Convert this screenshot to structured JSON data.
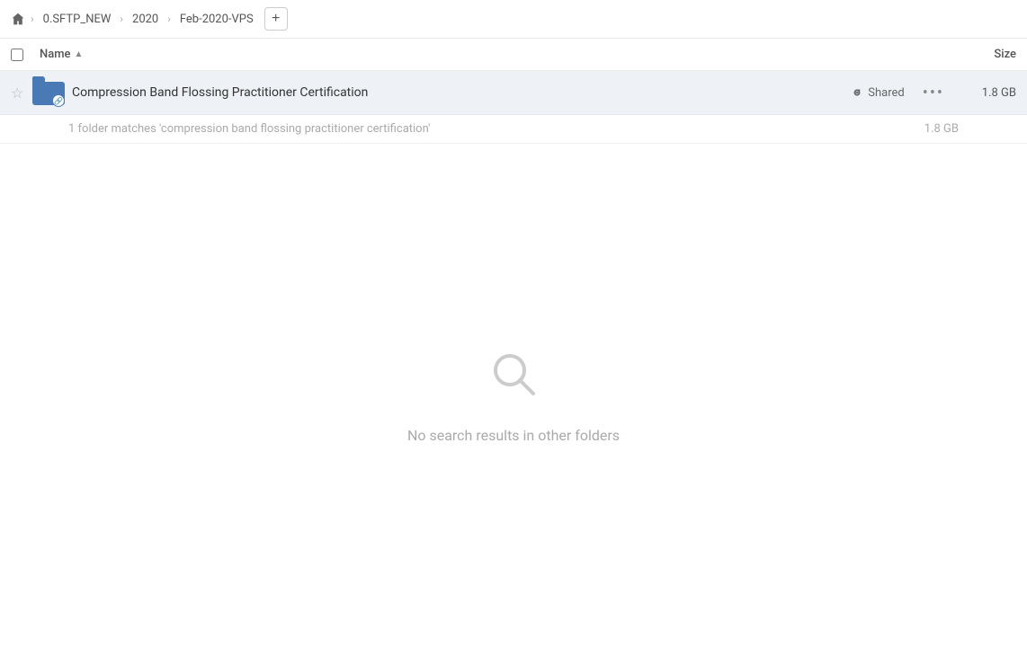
{
  "breadcrumb": {
    "home_icon": "🏠",
    "items": [
      {
        "label": "0.SFTP_NEW",
        "id": "sftp"
      },
      {
        "label": "2020",
        "id": "2020"
      },
      {
        "label": "Feb-2020-VPS",
        "id": "feb2020vps"
      }
    ],
    "add_button_label": "+"
  },
  "columns": {
    "name_label": "Name",
    "sort_arrow": "▲",
    "size_label": "Size"
  },
  "file_row": {
    "name": "Compression Band Flossing Practitioner Certification",
    "shared_label": "Shared",
    "size": "1.8 GB",
    "more_icon": "•••",
    "star_icon": "☆",
    "link_icon": "🔗"
  },
  "match_info": {
    "text": "1 folder matches 'compression band flossing practitioner certification'",
    "size": "1.8 GB"
  },
  "empty_state": {
    "icon": "🔍",
    "text": "No search results in other folders"
  }
}
